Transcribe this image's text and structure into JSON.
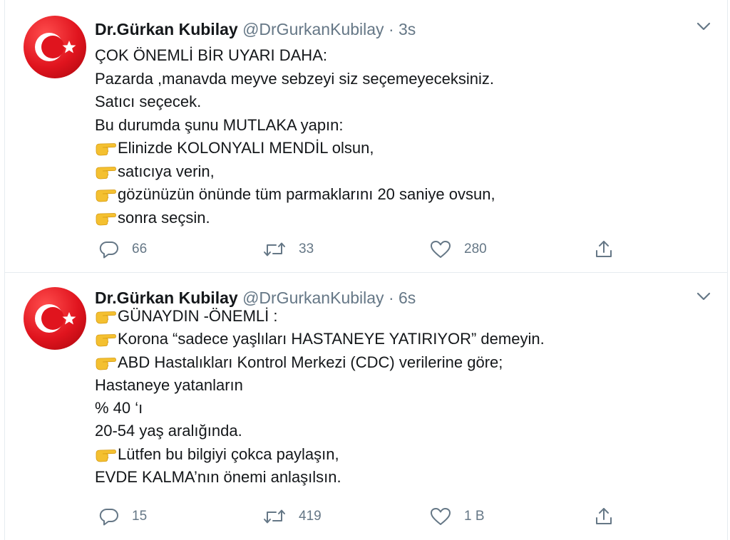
{
  "tweets": [
    {
      "author_name": "Dr.Gürkan Kubilay",
      "handle": "@DrGurkanKubilay",
      "separator": "·",
      "time": "3s",
      "lines": [
        {
          "hand": false,
          "text": "ÇOK ÖNEMLİ BİR UYARI DAHA:"
        },
        {
          "hand": false,
          "text": "Pazarda ,manavda meyve sebzeyi siz seçemeyeceksiniz."
        },
        {
          "hand": false,
          "text": "Satıcı seçecek."
        },
        {
          "hand": false,
          "text": "Bu durumda şunu MUTLAKA yapın:"
        },
        {
          "hand": true,
          "text": "Elinizde KOLONYALI MENDİL olsun,"
        },
        {
          "hand": true,
          "text": "satıcıya verin,"
        },
        {
          "hand": true,
          "text": "gözünüzün önünde tüm parmaklarını 20 saniye ovsun,"
        },
        {
          "hand": true,
          "text": "sonra seçsin."
        }
      ],
      "replies": "66",
      "retweets": "33",
      "likes": "280"
    },
    {
      "author_name": "Dr.Gürkan Kubilay",
      "handle": "@DrGurkanKubilay",
      "separator": "·",
      "time": "6s",
      "lines": [
        {
          "hand": true,
          "text": "GÜNAYDIN -ÖNEMLİ :"
        },
        {
          "hand": true,
          "text": "Korona “sadece yaşlıları HASTANEYE YATIRIYOR” demeyin."
        },
        {
          "hand": true,
          "text": "ABD Hastalıkları Kontrol Merkezi (CDC) verilerine göre;"
        },
        {
          "hand": false,
          "text": "Hastaneye yatanların"
        },
        {
          "hand": false,
          "text": "% 40 ‘ı"
        },
        {
          "hand": false,
          "text": "20-54 yaş aralığında."
        },
        {
          "hand": true,
          "text": "Lütfen bu bilgiyi çokca paylaşın,"
        },
        {
          "hand": false,
          "text": "EVDE KALMA’nın önemi anlaşılsın."
        }
      ],
      "replies": "15",
      "retweets": "419",
      "likes": "1 B"
    }
  ],
  "icons": {
    "reply": "reply-icon",
    "retweet": "retweet-icon",
    "like": "heart-icon",
    "share": "share-icon",
    "caret": "chevron-down-icon",
    "hand": "backhand-index-pointing-right-emoji"
  },
  "colors": {
    "text": "#14171a",
    "secondary": "#657786",
    "divider": "#e6ecf0",
    "avatar_red": "#e0141e",
    "hand_yellow": "#f4c030"
  }
}
